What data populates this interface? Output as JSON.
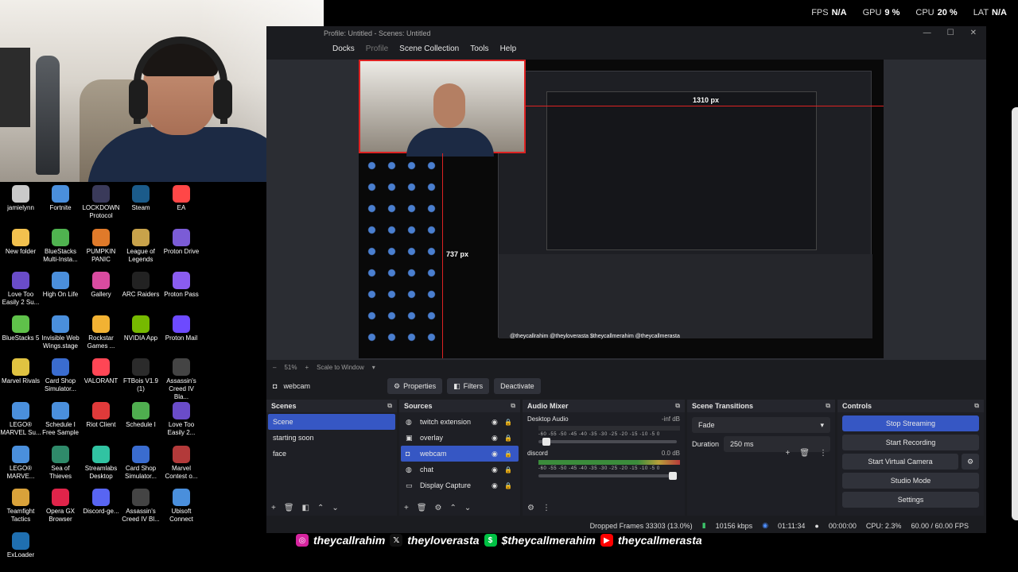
{
  "perf": [
    {
      "label": "FPS",
      "value": "N/A"
    },
    {
      "label": "GPU",
      "value": "9 %"
    },
    {
      "label": "CPU",
      "value": "20 %"
    },
    {
      "label": "LAT",
      "value": "N/A"
    }
  ],
  "desktop_icons": [
    {
      "label": "jamielynn",
      "color": "#c9c9c9"
    },
    {
      "label": "Fortnite",
      "color": "#4a8fdc"
    },
    {
      "label": "LOCKDOWN Protocol",
      "color": "#3a3a5a"
    },
    {
      "label": "Steam",
      "color": "#1b5b8a"
    },
    {
      "label": "EA",
      "color": "#ff4747"
    },
    {
      "label": "New folder",
      "color": "#f2c14e"
    },
    {
      "label": "BlueStacks Multi-Insta...",
      "color": "#4fb34f"
    },
    {
      "label": "PUMPKIN PANIC",
      "color": "#e07a2a"
    },
    {
      "label": "League of Legends",
      "color": "#c8a24a"
    },
    {
      "label": "Proton Drive",
      "color": "#7b5cd6"
    },
    {
      "label": "Love Too Easily 2 Su...",
      "color": "#6a4cc9"
    },
    {
      "label": "High On Life",
      "color": "#4a8fdc"
    },
    {
      "label": "Gallery",
      "color": "#d94ba0"
    },
    {
      "label": "ARC Raiders",
      "color": "#222"
    },
    {
      "label": "Proton Pass",
      "color": "#8a5cf0"
    },
    {
      "label": "BlueStacks 5",
      "color": "#5fc14a"
    },
    {
      "label": "Invisible Web Wings.stage",
      "color": "#4a8fdc"
    },
    {
      "label": "Rockstar Games ...",
      "color": "#f2b233"
    },
    {
      "label": "NVIDIA App",
      "color": "#76b900"
    },
    {
      "label": "Proton Mail",
      "color": "#6d4aff"
    },
    {
      "label": "Marvel Rivals",
      "color": "#e0c341"
    },
    {
      "label": "Card Shop Simulator...",
      "color": "#3a6ccf"
    },
    {
      "label": "VALORANT",
      "color": "#ff4655"
    },
    {
      "label": "FTBois V1.9 (1)",
      "color": "#2b2b2b"
    },
    {
      "label": "Assassin's Creed IV Bla...",
      "color": "#444"
    },
    {
      "label": "LEGO® MARVEL Su...",
      "color": "#4a8fdc"
    },
    {
      "label": "Schedule I Free Sample",
      "color": "#4a8fdc"
    },
    {
      "label": "Riot Client",
      "color": "#e03a3a"
    },
    {
      "label": "Schedule I",
      "color": "#4fae4f"
    },
    {
      "label": "Love Too Easily 2...",
      "color": "#6a4cc9"
    },
    {
      "label": "LEGO® MARVE...",
      "color": "#4a8fdc"
    },
    {
      "label": "Sea of Thieves",
      "color": "#2f8a6a"
    },
    {
      "label": "Streamlabs Desktop",
      "color": "#31c3a2"
    },
    {
      "label": "Card Shop Simulator...",
      "color": "#3a6ccf"
    },
    {
      "label": "Marvel Contest o...",
      "color": "#b33a3a"
    },
    {
      "label": "Teamfight Tactics",
      "color": "#d9a23a"
    },
    {
      "label": "Opera GX Browser",
      "color": "#e0244a"
    },
    {
      "label": "Discord-ge...",
      "color": "#5865f2"
    },
    {
      "label": "Assassin's Creed IV Bl...",
      "color": "#444"
    },
    {
      "label": "Ubisoft Connect",
      "color": "#4a8fdc"
    },
    {
      "label": "ExLoader",
      "color": "#1f6fb0"
    }
  ],
  "obs": {
    "title": "Profile: Untitled - Scenes: Untitled",
    "window_controls": [
      "—",
      "☐",
      "✕"
    ],
    "menu": [
      "Docks",
      "Profile",
      "Scene Collection",
      "Tools",
      "Help"
    ],
    "canvas_labels": {
      "width": "1310 px",
      "height": "737 px"
    },
    "canvas_socials": "@theycallrahim  @theyloverasta  $theycallmerahim  @theycallmerasta",
    "zoom": {
      "minus": "–",
      "level": "51%",
      "plus": "+",
      "mode": "Scale to Window"
    },
    "source_toolbar": {
      "selected_source": "webcam",
      "properties": "Properties",
      "filters": "Filters",
      "deactivate": "Deactivate"
    },
    "scenes": {
      "title": "Scenes",
      "items": [
        "Scene",
        "starting soon",
        "face"
      ],
      "selected": 0
    },
    "sources": {
      "title": "Sources",
      "items": [
        {
          "name": "twitch extension",
          "icon": "browser-icon"
        },
        {
          "name": "overlay",
          "icon": "image-icon"
        },
        {
          "name": "webcam",
          "icon": "camera-icon"
        },
        {
          "name": "chat",
          "icon": "browser-icon"
        },
        {
          "name": "Display Capture",
          "icon": "monitor-icon"
        }
      ],
      "selected": 2
    },
    "mixer": {
      "title": "Audio Mixer",
      "scale": "-60 -55 -50 -45 -40 -35 -30 -25 -20 -15 -10 -5 0",
      "channels": [
        {
          "name": "Desktop Audio",
          "db": "-inf dB",
          "level": 0.0,
          "fader": 0.03
        },
        {
          "name": "discord",
          "db": "0.0 dB",
          "level": 1.0,
          "fader": 1.0
        }
      ]
    },
    "transitions": {
      "title": "Scene Transitions",
      "selected": "Fade",
      "duration_label": "Duration",
      "duration": "250 ms"
    },
    "controls": {
      "title": "Controls",
      "stop_streaming": "Stop Streaming",
      "start_recording": "Start Recording",
      "start_virtual_camera": "Start Virtual Camera",
      "studio_mode": "Studio Mode",
      "settings": "Settings"
    },
    "status": {
      "dropped": "Dropped Frames 33303 (13.0%)",
      "bitrate": "10156 kbps",
      "stream_time": "01:11:34",
      "rec_time": "00:00:00",
      "cpu": "CPU: 2.3%",
      "fps": "60.00 / 60.00 FPS"
    }
  },
  "socials": [
    {
      "icon": "instagram-icon",
      "color": "#d6249f",
      "glyph": "◎",
      "handle": "theycallrahim"
    },
    {
      "icon": "x-icon",
      "color": "#111111",
      "glyph": "𝕏",
      "handle": "theyloverasta"
    },
    {
      "icon": "cashapp-icon",
      "color": "#00c244",
      "glyph": "$",
      "handle": "$theycallmerahim"
    },
    {
      "icon": "youtube-icon",
      "color": "#ff0000",
      "glyph": "▶",
      "handle": "theycallmerasta"
    }
  ]
}
